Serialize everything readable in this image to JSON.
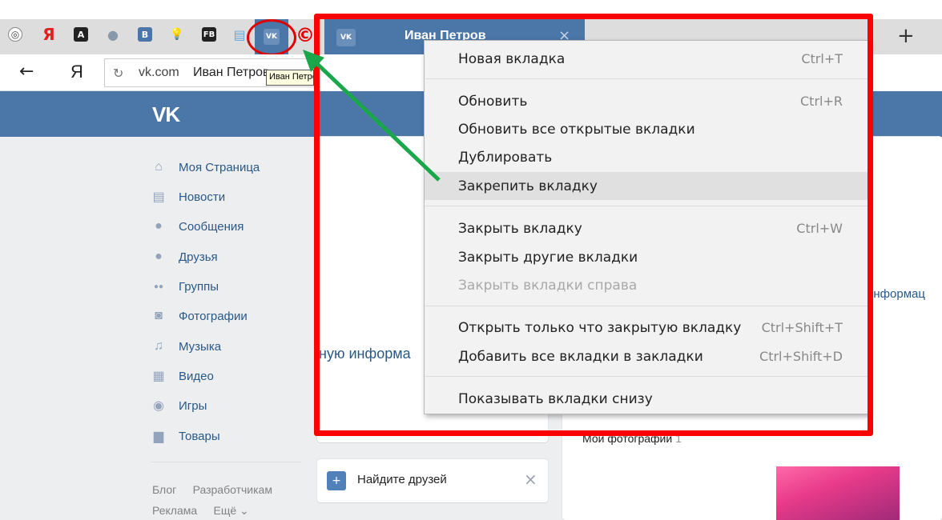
{
  "browser": {
    "pinned_tabs": [
      {
        "icon": "eye-icon",
        "glyph": "◎",
        "color": "#eeeeee"
      },
      {
        "icon": "yandex-icon",
        "glyph": "Я",
        "color": "#dddddd"
      },
      {
        "icon": "a-icon",
        "glyph": "A",
        "color": "#222222"
      },
      {
        "icon": "globe-icon",
        "glyph": "●",
        "color": "#8899aa"
      },
      {
        "icon": "b-icon",
        "glyph": "B",
        "color": "#4a76a8"
      },
      {
        "icon": "lightbulb-icon",
        "glyph": "💡",
        "color": "#dddddd"
      },
      {
        "icon": "fb-icon",
        "glyph": "FB",
        "color": "#222222"
      },
      {
        "icon": "notes-icon",
        "glyph": "▤",
        "color": "#88bbdd"
      }
    ],
    "active_tab_glyph": "VK",
    "tab_title": "Иван Петров",
    "tab_close": "×",
    "new_tab": "+",
    "back": "←",
    "yandex": "Я",
    "reload": "↻",
    "url": "vk.com",
    "page_title_in_bar": "Иван Петров",
    "tooltip": "Иван Петров",
    "copyright_glyph": "©"
  },
  "vk": {
    "logo": "VK",
    "nav": [
      {
        "label": "Моя Страница",
        "icon": "home-icon",
        "glyph": "⌂"
      },
      {
        "label": "Новости",
        "icon": "news-icon",
        "glyph": "▤"
      },
      {
        "label": "Сообщения",
        "icon": "messages-icon",
        "glyph": "●"
      },
      {
        "label": "Друзья",
        "icon": "friend-icon",
        "glyph": "●"
      },
      {
        "label": "Группы",
        "icon": "groups-icon",
        "glyph": "●●"
      },
      {
        "label": "Фотографии",
        "icon": "camera-icon",
        "glyph": "◙"
      },
      {
        "label": "Музыка",
        "icon": "music-icon",
        "glyph": "♫"
      },
      {
        "label": "Видео",
        "icon": "video-icon",
        "glyph": "▦"
      },
      {
        "label": "Игры",
        "icon": "gamepad-icon",
        "glyph": "◉"
      },
      {
        "label": "Товары",
        "icon": "bag-icon",
        "glyph": "▆"
      }
    ],
    "footer": [
      "Блог",
      "Разработчикам",
      "Реклама",
      "Ещё ⌄"
    ],
    "partial_info_left": "ную информа",
    "partial_info_right": "информац",
    "find_friends": "Найдите друзей",
    "find_friends_close": "×",
    "my_photos": "Мои фотографии",
    "my_photos_count": "1"
  },
  "menu": {
    "items": [
      {
        "label": "Новая вкладка",
        "shortcut": "Ctrl+T",
        "disabled": false
      },
      {
        "label": "Обновить",
        "shortcut": "Ctrl+R",
        "disabled": false
      },
      {
        "label": "Обновить все открытые вкладки",
        "shortcut": "",
        "disabled": false
      },
      {
        "label": "Дублировать",
        "shortcut": "",
        "disabled": false
      },
      {
        "label": "Закрепить вкладку",
        "shortcut": "",
        "disabled": false,
        "highlighted": true
      },
      {
        "label": "Закрыть вкладку",
        "shortcut": "Ctrl+W",
        "disabled": false
      },
      {
        "label": "Закрыть другие вкладки",
        "shortcut": "",
        "disabled": false
      },
      {
        "label": "Закрыть вкладки справа",
        "shortcut": "",
        "disabled": true
      },
      {
        "label": "Открыть только что закрытую вкладку",
        "shortcut": "Ctrl+Shift+T",
        "disabled": false
      },
      {
        "label": "Добавить все вкладки в закладки",
        "shortcut": "Ctrl+Shift+D",
        "disabled": false
      },
      {
        "label": "Показывать вкладки снизу",
        "shortcut": "",
        "disabled": false
      }
    ]
  },
  "colors": {
    "annotation_red": "#ff0000",
    "arrow_green": "#1aa64a",
    "vk_blue": "#4a76a8"
  }
}
